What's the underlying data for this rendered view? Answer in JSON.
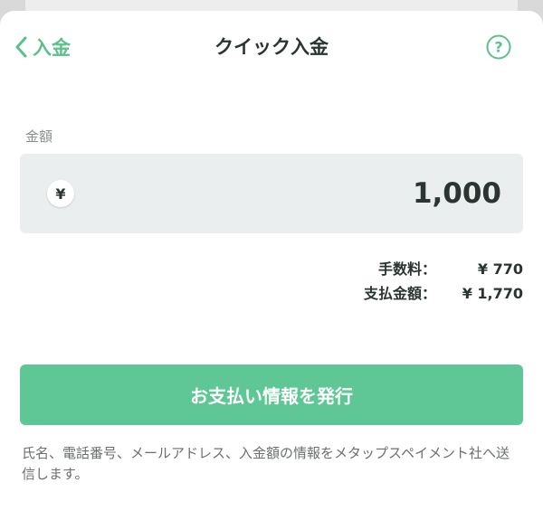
{
  "nav": {
    "back_label": "入金",
    "title": "クイック入金",
    "help_icon_glyph": "?"
  },
  "amount": {
    "label": "金額",
    "currency_symbol": "¥",
    "value": "1,000"
  },
  "fees": [
    {
      "label": "手数料：",
      "value": "¥ 770"
    },
    {
      "label": "支払金額：",
      "value": "¥ 1,770"
    }
  ],
  "actions": {
    "issue_button_label": "お支払い情報を発行"
  },
  "disclaimer": "氏名、電話番号、メールアドレス、入金額の情報をメタップスペイメント社へ送信します。",
  "colors": {
    "accent": "#5dbf8c",
    "button": "#5ec795",
    "field_bg": "#ebeeef",
    "text": "#2a3430"
  },
  "icons": {
    "back": "chevron-left-icon",
    "help": "question-circle-icon",
    "currency": "yen-icon"
  }
}
